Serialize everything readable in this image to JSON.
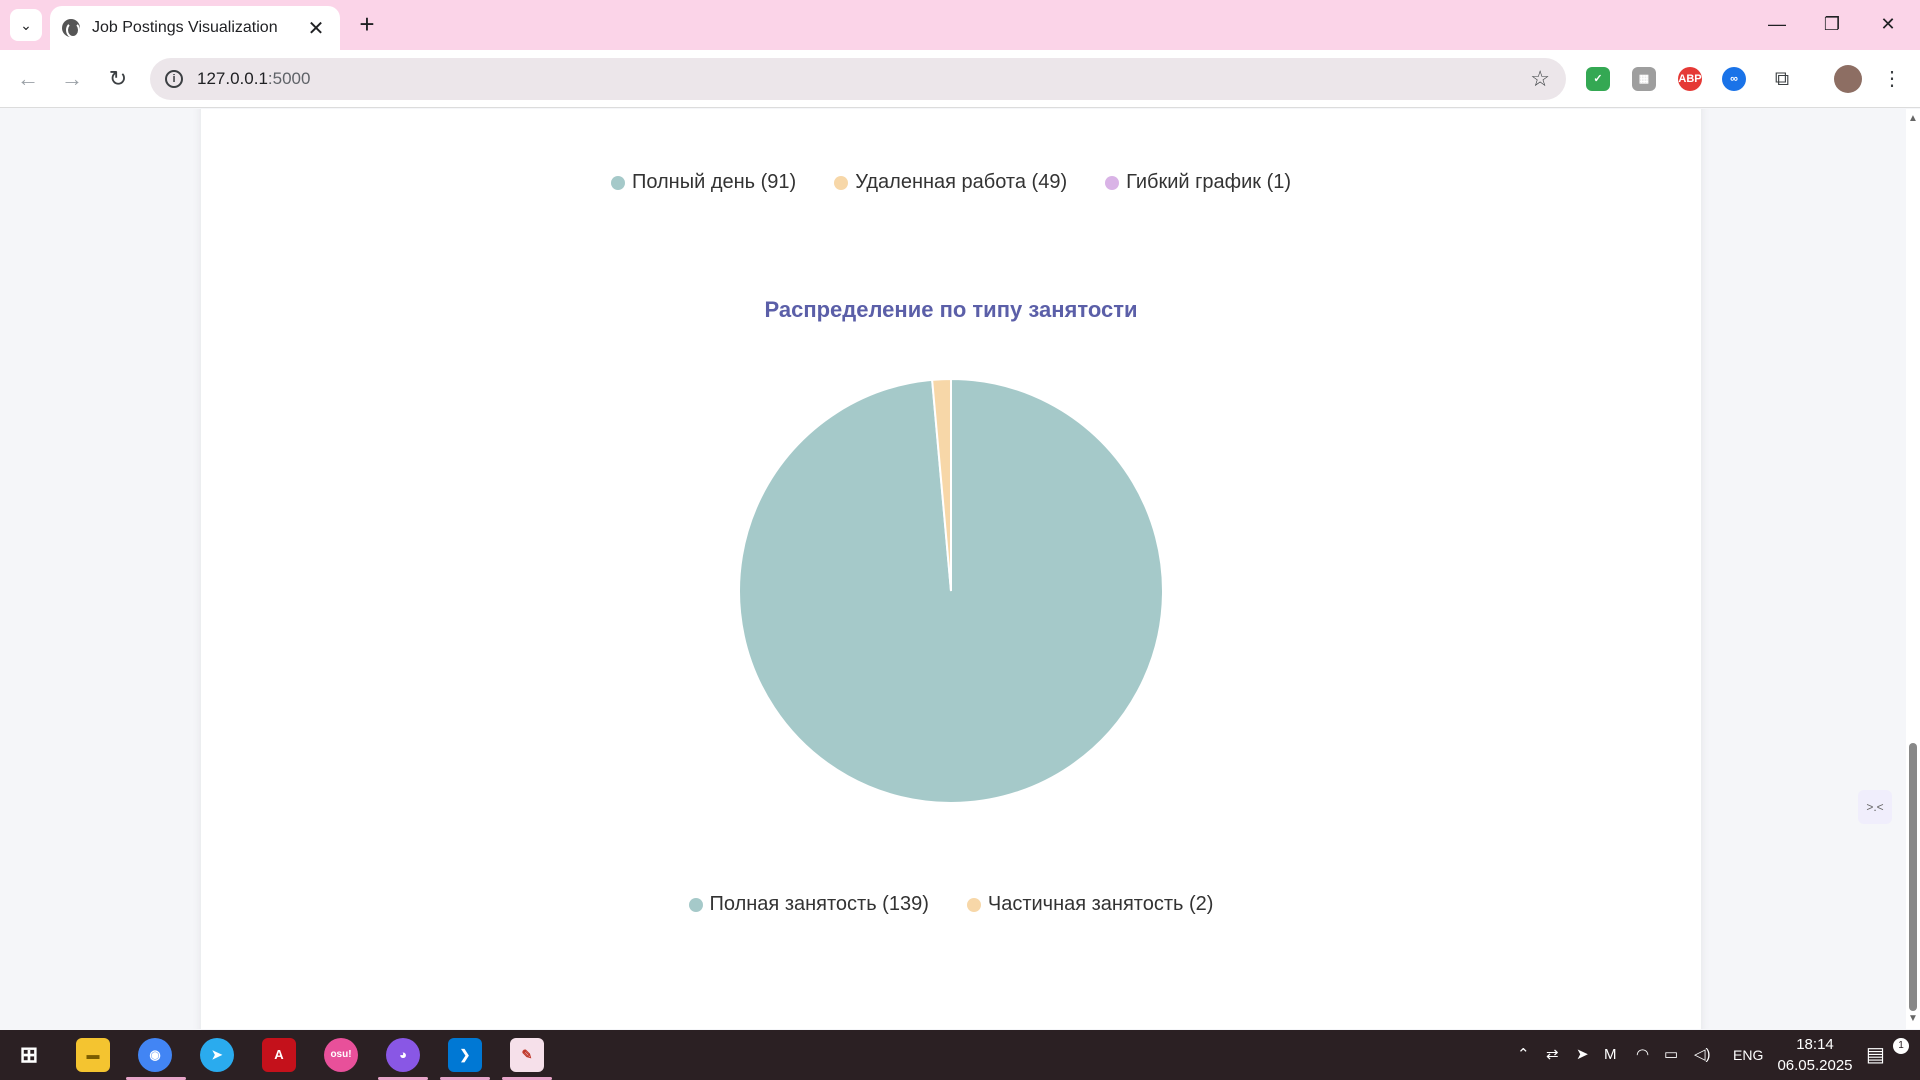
{
  "browser": {
    "tab_title": "Job Postings Visualization",
    "url_host": "127.0.0.1",
    "url_port": ":5000",
    "new_tab": "+",
    "close_tab": "✕"
  },
  "window_controls": {
    "minimize": "—",
    "maximize": "❐",
    "close": "✕"
  },
  "extensions": [
    {
      "name": "shield-extension-icon",
      "label": "✓",
      "color": "#34a853"
    },
    {
      "name": "image-extension-icon",
      "label": "▦",
      "color": "#9e9e9e"
    },
    {
      "name": "adblock-extension-icon",
      "label": "ABP",
      "color": "#e53935"
    },
    {
      "name": "infinity-extension-icon",
      "label": "∞",
      "color": "#1a73e8"
    }
  ],
  "page": {
    "top_legend": [
      {
        "label": "Полный день (91)",
        "color": "#a5c9c9"
      },
      {
        "label": "Удаленная работа (49)",
        "color": "#f7d7a8"
      },
      {
        "label": "Гибкий график (1)",
        "color": "#d9b3e6"
      }
    ]
  },
  "chart_data": {
    "type": "pie",
    "title": "Распределение по типу занятости",
    "categories": [
      "Полная занятость",
      "Частичная занятость"
    ],
    "values": [
      139,
      2
    ],
    "colors": [
      "#a5c9c9",
      "#f7d7a8"
    ],
    "legend_labels": [
      "Полная занятость (139)",
      "Частичная занятость (2)"
    ],
    "legend_position": "bottom"
  },
  "side_widget": {
    "label": ">.<"
  },
  "taskbar": {
    "language": "ENG",
    "time": "18:14",
    "date": "06.05.2025",
    "notifications": "1"
  }
}
